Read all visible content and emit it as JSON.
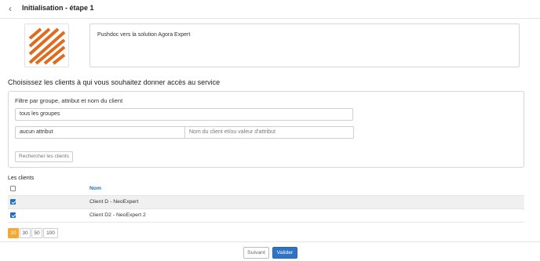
{
  "header": {
    "back_icon": "chevron-left-icon",
    "title": "Initialisation - étape 1"
  },
  "service": {
    "logo": "agora-expert-logo",
    "logo_color": "#e06b1f",
    "description": "Pushdoc vers la solution Agora Expert"
  },
  "section_title": "Choisissez les clients à qui vous souhaitez donner accès au service",
  "filter": {
    "label": "Filtre par groupe, attribut et nom du client",
    "group_value": "tous les groupes",
    "attribute_value": "aucun attribut",
    "name_placeholder": "Nom du client et/ou valeur d'attribut",
    "search_button": "Rechercher les clients"
  },
  "clients": {
    "label": "Les clients",
    "column_name": "Nom",
    "rows": [
      {
        "name": "Client D - NeoExpert",
        "checked": true
      },
      {
        "name": "Client D2 - NeoExpert 2",
        "checked": true
      }
    ]
  },
  "pagination": {
    "sizes": [
      "10",
      "30",
      "50",
      "100"
    ],
    "active": "10"
  },
  "footer": {
    "next_button": "Suivant",
    "validate_button": "Valider"
  },
  "colors": {
    "accent_blue": "#2f73c4",
    "accent_orange": "#f5a833"
  }
}
